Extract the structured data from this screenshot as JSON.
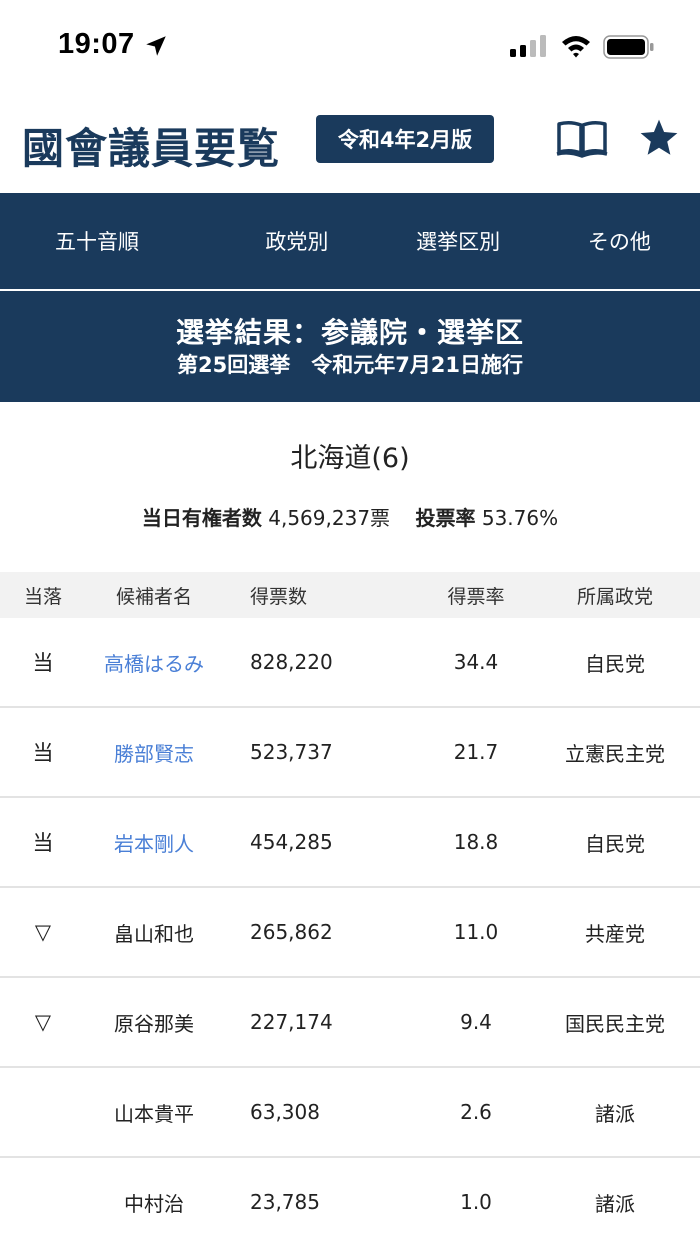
{
  "status_bar": {
    "time": "19:07"
  },
  "header": {
    "title": "國會議員要覧",
    "edition": "令和4年2月版",
    "icons": [
      "book-icon",
      "star-icon"
    ]
  },
  "nav": {
    "tabs": [
      {
        "label": "五十音順"
      },
      {
        "label": "政党別"
      },
      {
        "label": "選挙区別"
      },
      {
        "label": "その他"
      }
    ]
  },
  "banner": {
    "title": "選挙結果：参議院・選挙区",
    "subtitle": "第25回選挙　令和元年7月21日施行"
  },
  "region": {
    "title": "北海道(6)",
    "voters_label": "当日有権者数",
    "voters_value": "4,569,237票",
    "turnout_label": "投票率",
    "turnout_value": "53.76%"
  },
  "table": {
    "headers": {
      "result": "当落",
      "name": "候補者名",
      "votes": "得票数",
      "rate": "得票率",
      "party": "所属政党"
    },
    "rows": [
      {
        "result": "当",
        "name": "高橋はるみ",
        "votes": "828,220",
        "rate": "34.4",
        "party": "自民党",
        "linked": true
      },
      {
        "result": "当",
        "name": "勝部賢志",
        "votes": "523,737",
        "rate": "21.7",
        "party": "立憲民主党",
        "linked": true
      },
      {
        "result": "当",
        "name": "岩本剛人",
        "votes": "454,285",
        "rate": "18.8",
        "party": "自民党",
        "linked": true
      },
      {
        "result": "▽",
        "name": "畠山和也",
        "votes": "265,862",
        "rate": "11.0",
        "party": "共産党",
        "linked": false
      },
      {
        "result": "▽",
        "name": "原谷那美",
        "votes": "227,174",
        "rate": "9.4",
        "party": "国民民主党",
        "linked": false
      },
      {
        "result": "",
        "name": "山本貴平",
        "votes": "63,308",
        "rate": "2.6",
        "party": "諸派",
        "linked": false
      },
      {
        "result": "",
        "name": "中村治",
        "votes": "23,785",
        "rate": "1.0",
        "party": "諸派",
        "linked": false
      }
    ]
  },
  "colors": {
    "brand": "#1a3a5c",
    "link": "#4a7fd6",
    "header_bg": "#f2f2f2"
  }
}
